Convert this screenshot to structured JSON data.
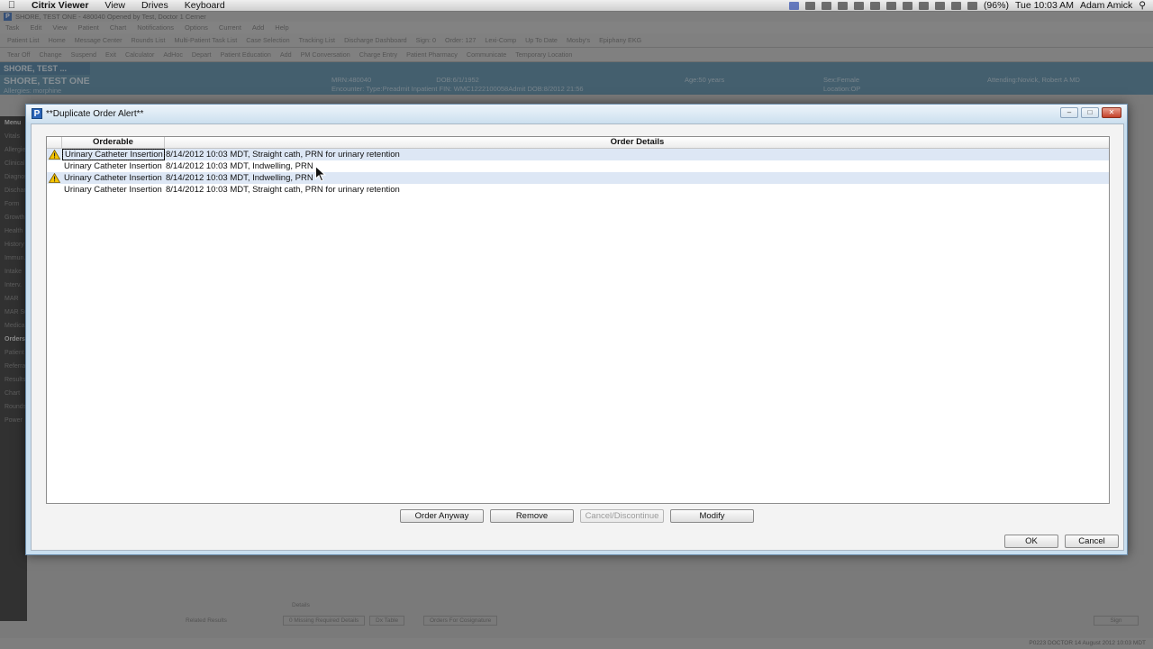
{
  "mac_menubar": {
    "app_name": "Citrix Viewer",
    "menus": [
      "View",
      "Drives",
      "Keyboard"
    ],
    "battery": "(96%)",
    "clock": "Tue 10:03 AM",
    "user": "Adam Amick"
  },
  "dialog": {
    "title": "**Duplicate Order Alert**",
    "columns": {
      "orderable": "Orderable",
      "order_details": "Order Details"
    },
    "rows": [
      {
        "warning": true,
        "highlighted": true,
        "focused": true,
        "orderable": "Urinary Catheter Insertion",
        "details": "8/14/2012 10:03 MDT, Straight cath, PRN for urinary retention"
      },
      {
        "warning": false,
        "highlighted": false,
        "focused": false,
        "orderable": "Urinary Catheter Insertion",
        "details": "8/14/2012 10:03 MDT, Indwelling, PRN"
      },
      {
        "warning": true,
        "highlighted": true,
        "focused": false,
        "orderable": "Urinary Catheter Insertion",
        "details": "8/14/2012 10:03 MDT, Indwelling, PRN"
      },
      {
        "warning": false,
        "highlighted": false,
        "focused": false,
        "orderable": "Urinary Catheter Insertion",
        "details": "8/14/2012 10:03 MDT, Straight cath, PRN for urinary retention"
      }
    ],
    "buttons": {
      "order_anyway": "Order Anyway",
      "remove": "Remove",
      "cancel_discontinue": "Cancel/Discontinue",
      "modify": "Modify",
      "ok": "OK",
      "cancel": "Cancel"
    },
    "colors": {
      "row_highlight": "#dde7f5",
      "title_bar": "#cde0ef",
      "warning_yellow": "#f5c400"
    }
  },
  "host_app": {
    "window_title": "SHORE, TEST ONE - 480040 Opened by Test, Doctor 1 Cerner",
    "menus": [
      "Task",
      "Edit",
      "View",
      "Patient",
      "Chart",
      "Notifications",
      "Options",
      "Current",
      "Add",
      "Help"
    ],
    "toolbar_items": [
      "Patient List",
      "Home",
      "Message Center",
      "Rounds List",
      "Multi-Patient Task List",
      "Case Selection",
      "Tracking List",
      "Discharge Dashboard",
      "Sign: 0",
      "Order: 127",
      "Lexi-Comp",
      "Up To Date",
      "Mosby's",
      "Epiphany EKG"
    ],
    "toolbar2_items": [
      "Tear Off",
      "Change",
      "Suspend",
      "Exit",
      "Calculator",
      "AdHoc",
      "Depart",
      "Patient Education",
      "Add",
      "PM Conversation",
      "Charge Entry",
      "Patient Pharmacy",
      "Communicate",
      "Temporary Location"
    ],
    "patient_tab": "SHORE, TEST ...",
    "patient_name": "SHORE, TEST ONE",
    "allergies": "Allergies: morphine",
    "mrn": "MRN:480040",
    "dob": "DOB:6/1/1952",
    "encounter": "Encounter: Type:Preadmit Inpatient FIN: WMC1222100058Admit DOB:8/2012 21:56",
    "age": "Age:50 years",
    "sex": "Sex:Female",
    "location": "Location:OP",
    "attending": "Attending:Novick, Robert A MD",
    "left_nav": [
      "Menu",
      "Vitals",
      "Allergies",
      "Clinical",
      "Diagnoses",
      "Discharge",
      "Form",
      "Growth",
      "Health",
      "History",
      "Immun.",
      "Intake",
      "Interv.",
      "MAR",
      "MAR Sum.",
      "Medical",
      "Orders",
      "Patient",
      "Referral",
      "Results",
      "Chart",
      "Rounds",
      "Power"
    ],
    "details_label": "Details",
    "related_results": "Related Results",
    "missing_required": "0 Missing Required Details",
    "dx_table": "Dx Table",
    "orders_cosign": "Orders For Cosignature",
    "sign": "Sign",
    "status": "P0223  DOCTOR  14 August 2012  10:03 MDT"
  }
}
